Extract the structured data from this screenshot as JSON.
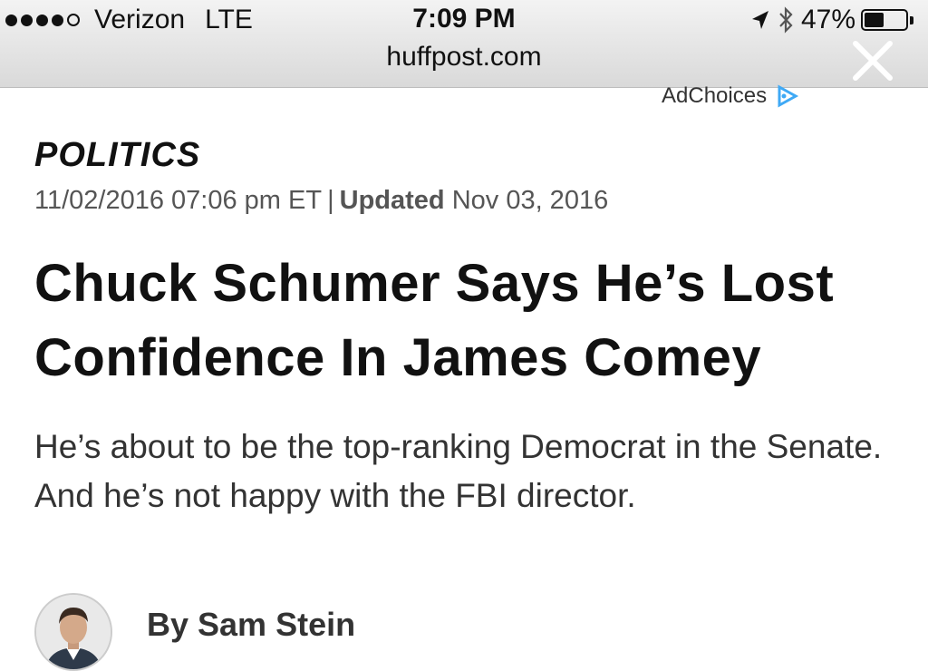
{
  "status_bar": {
    "carrier": "Verizon",
    "network": "LTE",
    "time": "7:09 PM",
    "battery_text": "47%",
    "battery_level": 0.47,
    "domain": "huffpost.com",
    "icons": [
      "signal-dots-icon",
      "location-arrow-icon",
      "bluetooth-icon",
      "battery-icon"
    ]
  },
  "browser": {
    "close_icon": "close-icon"
  },
  "ad": {
    "label": "AdChoices",
    "icon": "adchoices-icon"
  },
  "article": {
    "section": "POLITICS",
    "published": "11/02/2016 07:06 pm ET",
    "separator": "|",
    "updated_label": "Updated",
    "updated_date": "Nov 03, 2016",
    "headline": "Chuck Schumer Says He’s Lost Confidence In James Comey",
    "dek": "He’s about to be the top-ranking Democrat in the Senate. And he’s not happy with the FBI director.",
    "byline": "By Sam Stein"
  },
  "colors": {
    "status_bg": "#e5e5e5",
    "adchoices_accent": "#3fa9f5",
    "text_dark": "#111111",
    "text_muted": "#555555"
  }
}
